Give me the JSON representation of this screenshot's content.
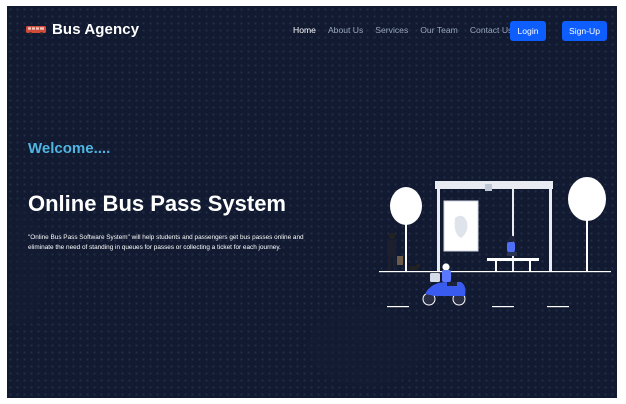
{
  "brand": {
    "name": "Bus Agency"
  },
  "nav": {
    "links": [
      "Home",
      "About Us",
      "Services",
      "Our Team",
      "Contact Us"
    ],
    "active": "Home",
    "login_label": "Login",
    "signup_label": "Sign-Up"
  },
  "hero": {
    "welcome": "Welcome....",
    "title": "Online Bus Pass System",
    "description": "\"Online Bus Pass Software System\" will help students and passengers get bus passes online and eliminate the need of standing in queues for passes or collecting a ticket for each journey."
  },
  "colors": {
    "background": "#111a30",
    "accent": "#0d5dff",
    "welcome_text": "#4fb6e3"
  },
  "icons": [
    "bus-logo-icon",
    "bus-stop-illustration"
  ]
}
